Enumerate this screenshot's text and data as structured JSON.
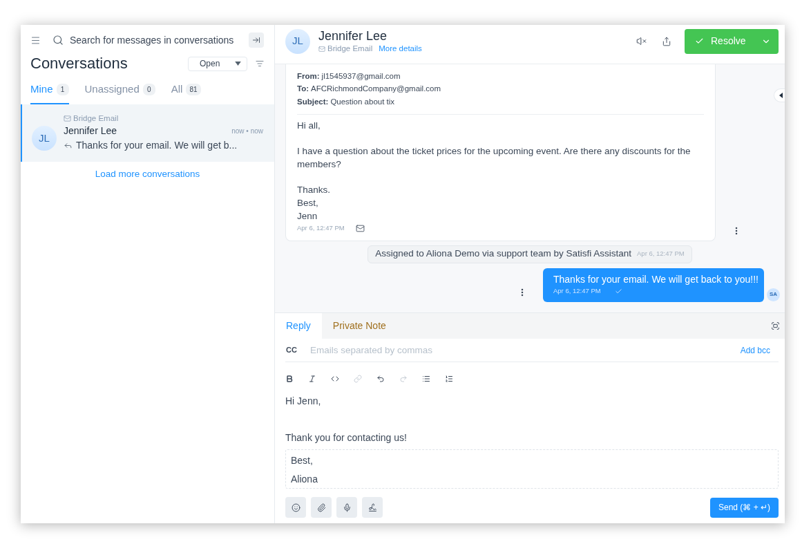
{
  "sidebar": {
    "search": {
      "placeholder": "Search for messages in conversations"
    },
    "title": "Conversations",
    "status_filter": {
      "value": "Open"
    },
    "tabs": [
      {
        "label": "Mine",
        "count": "1",
        "selected": true
      },
      {
        "label": "Unassigned",
        "count": "0",
        "selected": false
      },
      {
        "label": "All",
        "count": "81",
        "selected": false
      }
    ],
    "conversations": [
      {
        "channel": "Bridge Email",
        "initials": "JL",
        "name": "Jennifer Lee",
        "time": "now • now",
        "preview": "Thanks for your email. We will get b...",
        "selected": true
      }
    ],
    "load_more": "Load more conversations"
  },
  "header": {
    "initials": "JL",
    "name": "Jennifer Lee",
    "channel": "Bridge Email",
    "details_link": "More details",
    "resolve_button": "Resolve"
  },
  "messages": [
    {
      "kind": "email",
      "fields": [
        {
          "label": "From:",
          "value": "jl1545937@gmail.com"
        },
        {
          "label": "To:",
          "value": "AFCRichmondCompany@gmail.com"
        },
        {
          "label": "Subject:",
          "value": "Question about tix"
        }
      ],
      "paragraphs": [
        [
          "Hi all,"
        ],
        [
          "I have a question about the ticket prices for the upcoming event. Are there any discounts for the members?"
        ],
        [
          "Thanks.",
          "Best,",
          "Jenn"
        ]
      ],
      "time": "Apr 6, 12:47 PM"
    },
    {
      "kind": "activity",
      "text": "Assigned to Aliona Demo via support team by Satisfi Assistant",
      "time": "Apr 6, 12:47 PM"
    },
    {
      "kind": "outgoing",
      "text": "Thanks for your email. We will get back to you!!!",
      "time": "Apr 6, 12:47 PM",
      "sender_initials": "SA"
    }
  ],
  "composer": {
    "tabs": [
      {
        "kind": "reply",
        "label": "Reply",
        "selected": true
      },
      {
        "kind": "private_note",
        "label": "Private Note",
        "selected": false
      }
    ],
    "cc": {
      "label": "CC",
      "placeholder": "Emails separated by commas"
    },
    "add_bcc": "Add bcc",
    "toolbar": [
      {
        "kind": "bold",
        "disabled": false
      },
      {
        "kind": "italic",
        "disabled": false
      },
      {
        "kind": "code",
        "disabled": false
      },
      {
        "kind": "link",
        "disabled": true
      },
      {
        "kind": "undo",
        "disabled": false
      },
      {
        "kind": "redo",
        "disabled": true
      },
      {
        "kind": "bullet_list",
        "disabled": false
      },
      {
        "kind": "ordered_list",
        "disabled": false
      }
    ],
    "paragraphs": [
      "Hi Jenn,",
      "Thank you for contacting us!"
    ],
    "signature": [
      "Best,",
      "Aliona"
    ],
    "actions": [
      {
        "kind": "emoji"
      },
      {
        "kind": "attach"
      },
      {
        "kind": "audio"
      },
      {
        "kind": "signature"
      }
    ],
    "send_button": "Send (⌘ + ↵)"
  }
}
